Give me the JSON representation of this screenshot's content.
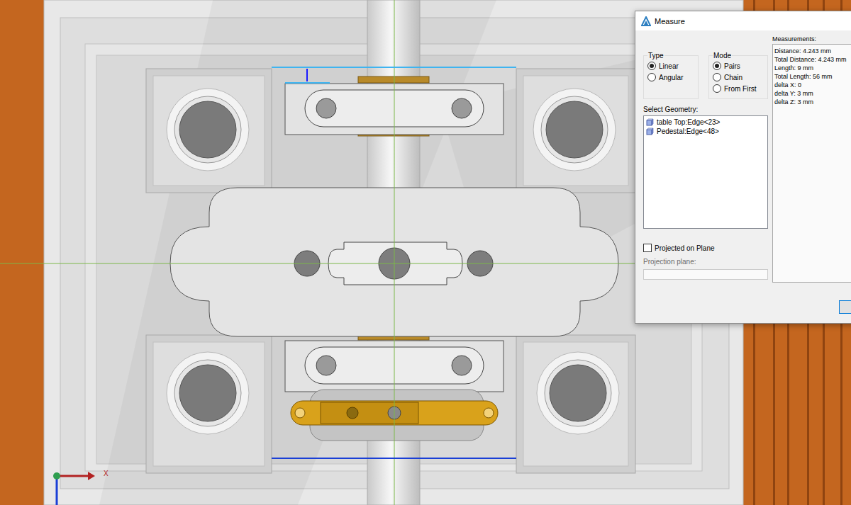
{
  "window": {
    "title": "Measure"
  },
  "type": {
    "label": "Type",
    "options": [
      {
        "label": "Linear",
        "selected": true
      },
      {
        "label": "Angular",
        "selected": false
      }
    ]
  },
  "mode": {
    "label": "Mode",
    "options": [
      {
        "label": "Pairs",
        "selected": true
      },
      {
        "label": "Chain",
        "selected": false
      },
      {
        "label": "From First",
        "selected": false
      }
    ]
  },
  "select_geometry": {
    "label": "Select Geometry:",
    "items": [
      {
        "label": "table Top:Edge<23>",
        "selected": false
      },
      {
        "label": "Pedestal:Edge<48>",
        "selected": false
      }
    ]
  },
  "projected_on_plane": {
    "label": "Projected on Plane",
    "checked": false
  },
  "projection_plane": {
    "label": "Projection plane:",
    "value": "",
    "disabled": true
  },
  "measurements": {
    "label": "Measurements:",
    "lines": [
      "Distance: 4.243 mm",
      "Total Distance: 4.243 mm",
      "Length: 9 mm",
      "Total Length: 56 mm",
      "delta X:  0",
      "delta Y: 3 mm",
      "delta Z: 3 mm"
    ]
  },
  "viewport": {
    "axis_label": "X"
  }
}
